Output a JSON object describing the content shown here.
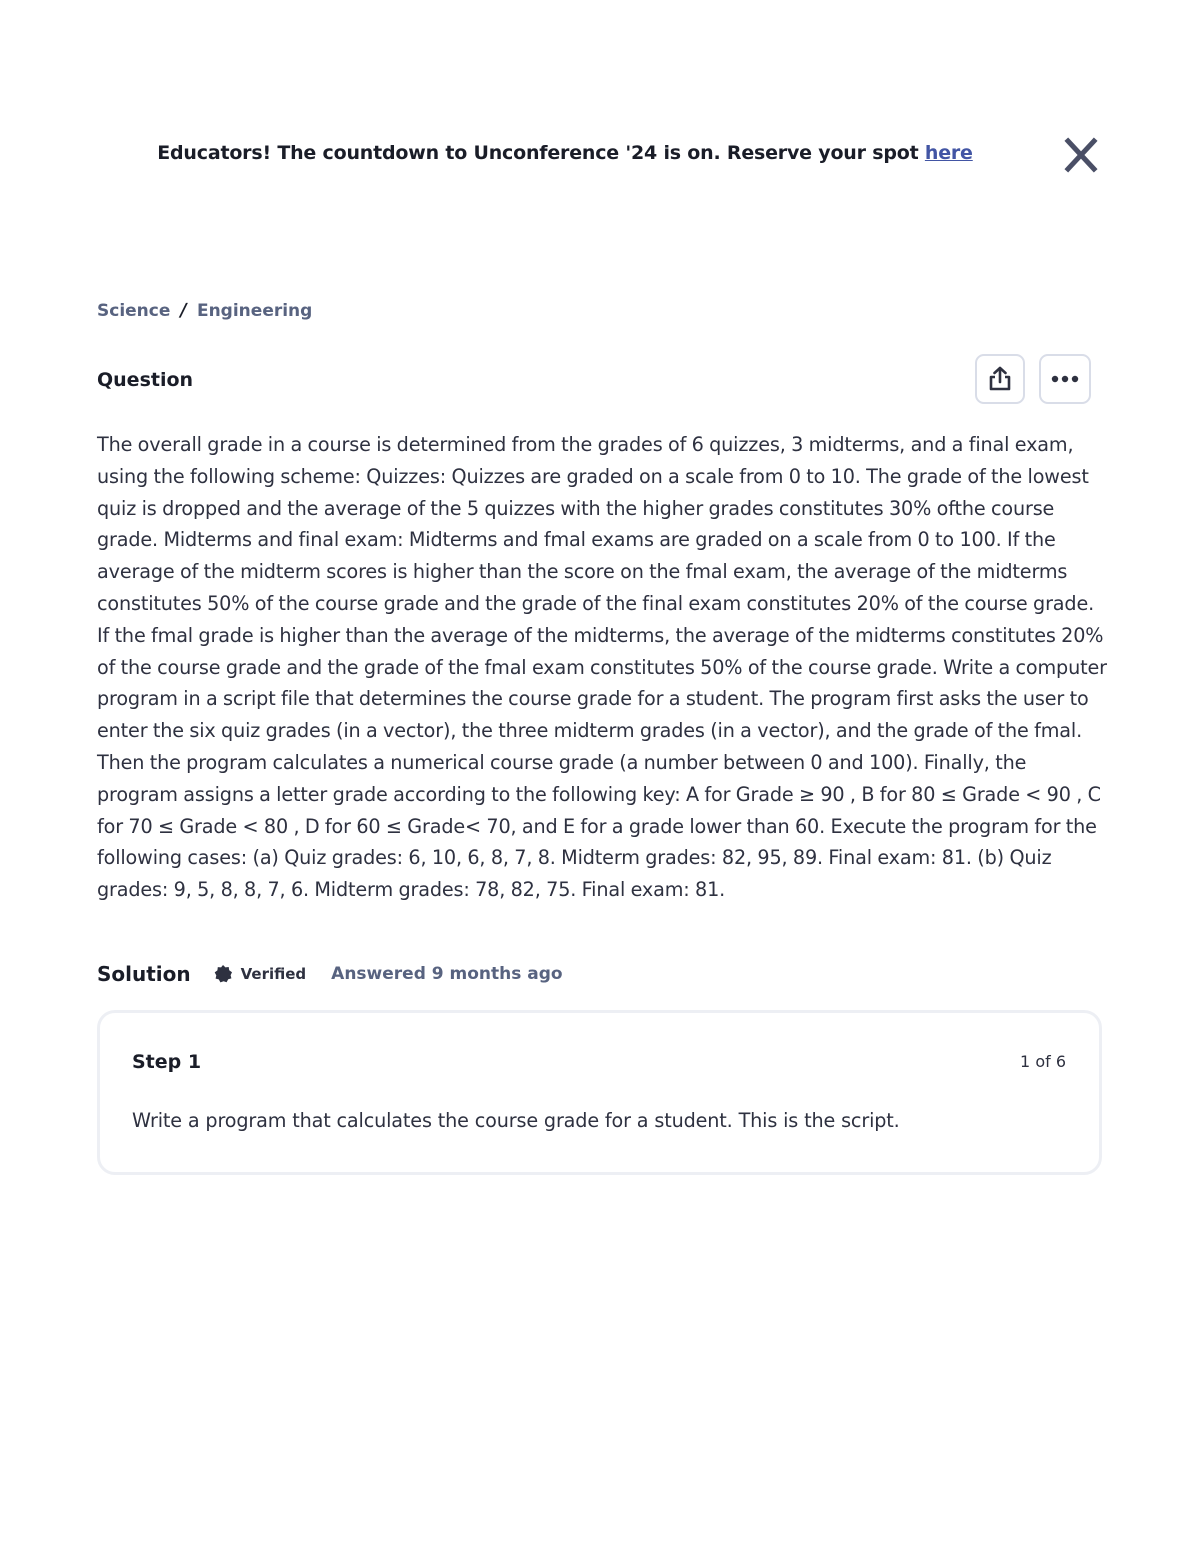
{
  "banner": {
    "text": "Educators! The countdown to Unconference '24 is on. Reserve your spot ",
    "link_label": "here"
  },
  "breadcrumb": {
    "items": [
      "Science",
      "Engineering"
    ],
    "separator": "/"
  },
  "question": {
    "label": "Question",
    "text": "The overall grade in a course is determined from the grades of 6 quizzes, 3 midterms, and a final exam, using the following scheme: Quizzes: Quizzes are graded on a scale from 0 to 10. The grade of the lowest quiz is dropped and the average of the 5 quizzes with the higher grades constitutes 30% ofthe course grade. Midterms and final exam: Midterms and fmal exams are graded on a scale from 0 to 100. If the average of the midterm scores is higher than the score on the fmal exam, the average of the midterms constitutes 50% of the course grade and the grade of the final exam constitutes 20% of the course grade. If the fmal grade is higher than the average of the midterms, the average of the midterms constitutes 20% of the course grade and the grade of the fmal exam constitutes 50% of the course grade. Write a computer program in a script file that determines the course grade for a student. The program first asks the user to enter the six quiz grades (in a vector), the three midterm grades (in a vector), and the grade of the fmal. Then the program calculates a numerical course grade (a number between 0 and 100). Finally, the program assigns a letter grade according to the following key: A for Grade ≥ 90 , B for 80 ≤ Grade < 90 , C for 70 ≤ Grade < 80 , D for 60 ≤ Grade< 70, and E for a grade lower than 60. Execute the program for the following cases: (a) Quiz grades: 6, 10, 6, 8, 7, 8. Midterm grades: 82, 95, 89. Final exam: 81. (b) Quiz grades: 9, 5, 8, 8, 7, 6. Midterm grades: 78, 82, 75. Final exam: 81."
  },
  "solution": {
    "label": "Solution",
    "verified_label": "Verified",
    "answered": "Answered 9 months ago"
  },
  "step": {
    "title": "Step 1",
    "count": "1 of 6",
    "text": "Write a program that calculates the course grade for a student. This is the script."
  },
  "icons": {
    "close": "close-icon",
    "share": "share-icon",
    "more": "more-icon",
    "verified": "verified-badge-icon"
  },
  "colors": {
    "link": "#4255a4",
    "muted": "#586380",
    "text": "#2e3140",
    "border": "#edeff4"
  }
}
